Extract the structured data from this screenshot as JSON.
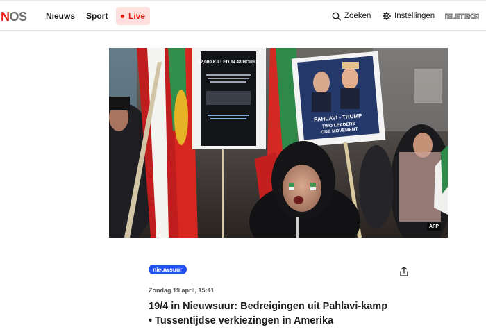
{
  "header": {
    "logo": "NOS",
    "nav": [
      {
        "label": "Nieuws"
      },
      {
        "label": "Sport"
      }
    ],
    "live_label": "Live",
    "search_label": "Zoeken",
    "settings_label": "Instellingen",
    "teletekst_label": "TELETEKST"
  },
  "article": {
    "image_credit": "AFP",
    "image_texts": {
      "poster_left_headline": "12,000 KILLED IN 48 HOURS",
      "poster_right_line1": "PAHLAVI - TRUMP",
      "poster_right_line2": "TWO LEADERS",
      "poster_right_line3": "ONE MOVEMENT"
    },
    "badge": "nieuwsuur",
    "date": "Zondag 19 april, 15:41",
    "title": "19/4 in Nieuwsuur: Bedreigingen uit Pahlavi-kamp • Tussentijdse verkiezingen in Amerika"
  },
  "colors": {
    "brand_red": "#e61e14",
    "live_bg": "#fde0de",
    "badge_blue": "#2253ed"
  },
  "icons": {
    "search": "search-icon",
    "settings": "gear-icon",
    "share": "share-icon"
  }
}
